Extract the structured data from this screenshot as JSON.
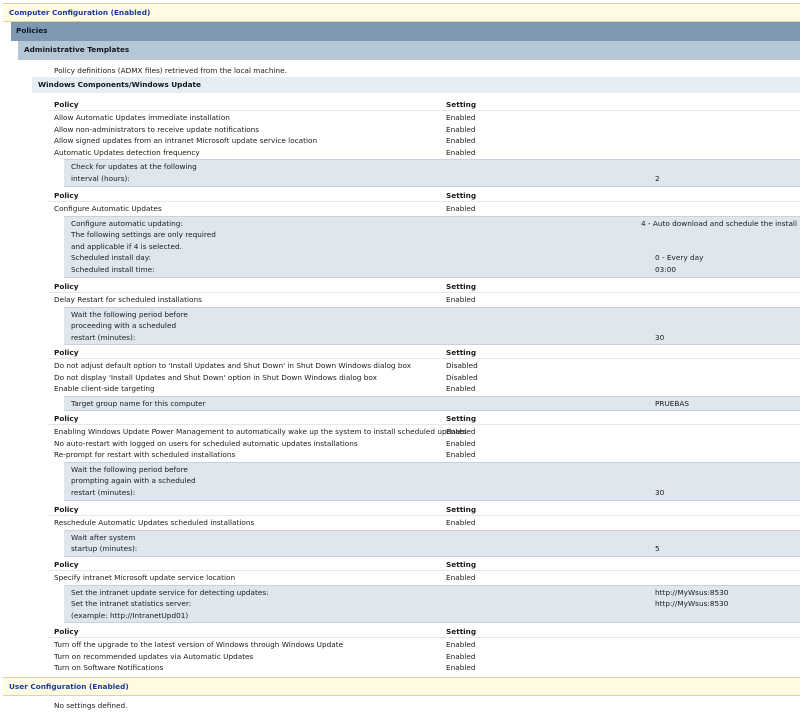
{
  "computer_config": {
    "title": "Computer Configuration (Enabled)",
    "policies_label": "Policies",
    "admin_templates_label": "Administrative Templates",
    "admx_note": "Policy definitions (ADMX files) retrieved from the local machine.",
    "component_label": "Windows Components/Windows Update"
  },
  "col_policy": "Policy",
  "col_setting": "Setting",
  "groups": [
    {
      "rows": [
        {
          "policy": "Allow Automatic Updates immediate installation",
          "setting": "Enabled"
        },
        {
          "policy": "Allow non-administrators to receive update notifications",
          "setting": "Enabled"
        },
        {
          "policy": "Allow signed updates from an intranet Microsoft update service location",
          "setting": "Enabled"
        },
        {
          "policy": "Automatic Updates detection frequency",
          "setting": "Enabled"
        }
      ],
      "details": [
        {
          "label": "Check for updates at the following",
          "value": ""
        },
        {
          "label": "interval (hours):",
          "value": "2"
        }
      ]
    },
    {
      "rows": [
        {
          "policy": "Configure Automatic Updates",
          "setting": "Enabled"
        }
      ],
      "details": [
        {
          "label": "Configure automatic updating:",
          "value": "4 - Auto download and schedule the install"
        },
        {
          "label": "The following settings are only required",
          "value": ""
        },
        {
          "label": "and applicable if 4 is selected.",
          "value": ""
        },
        {
          "label": "Scheduled install day:",
          "value": "0 - Every day"
        },
        {
          "label": "Scheduled install time:",
          "value": "03:00"
        }
      ]
    },
    {
      "rows": [
        {
          "policy": "Delay Restart for scheduled installations",
          "setting": "Enabled"
        }
      ],
      "details": [
        {
          "label": "Wait the following period before",
          "value": ""
        },
        {
          "label": "proceeding with a scheduled",
          "value": ""
        },
        {
          "label": "restart (minutes):",
          "value": "30"
        }
      ]
    },
    {
      "rows": [
        {
          "policy": "Do not adjust default option to 'Install Updates and Shut Down' in Shut Down Windows dialog box",
          "setting": "Disabled"
        },
        {
          "policy": "Do not display 'Install Updates and Shut Down' option in Shut Down Windows dialog box",
          "setting": "Disabled"
        },
        {
          "policy": "Enable client-side targeting",
          "setting": "Enabled"
        }
      ],
      "details": [
        {
          "label": "Target group name for this computer",
          "value": "PRUEBAS"
        }
      ]
    },
    {
      "rows": [
        {
          "policy": "Enabling Windows Update Power Management to automatically wake up the system to install scheduled updates",
          "setting": "Enabled"
        },
        {
          "policy": "No auto-restart with logged on users for scheduled automatic updates installations",
          "setting": "Enabled"
        },
        {
          "policy": "Re-prompt for restart with scheduled installations",
          "setting": "Enabled"
        }
      ],
      "details": [
        {
          "label": "Wait the following period before",
          "value": ""
        },
        {
          "label": "prompting again with a scheduled",
          "value": ""
        },
        {
          "label": "restart (minutes):",
          "value": "30"
        }
      ]
    },
    {
      "rows": [
        {
          "policy": "Reschedule Automatic Updates scheduled installations",
          "setting": "Enabled"
        }
      ],
      "details": [
        {
          "label": "Wait after system",
          "value": ""
        },
        {
          "label": "startup (minutes):",
          "value": "5"
        }
      ]
    },
    {
      "rows": [
        {
          "policy": "Specify intranet Microsoft update service location",
          "setting": "Enabled"
        }
      ],
      "details": [
        {
          "label": "Set the intranet update service for detecting updates:",
          "value": "http://MyWsus:8530"
        },
        {
          "label": "Set the intranet statistics server:",
          "value": "http://MyWsus:8530"
        },
        {
          "label": "(example: http://IntranetUpd01)",
          "value": ""
        }
      ]
    },
    {
      "rows": [
        {
          "policy": "Turn off the upgrade to the latest version of Windows through Windows Update",
          "setting": "Enabled"
        },
        {
          "policy": "Turn on recommended updates via Automatic Updates",
          "setting": "Enabled"
        },
        {
          "policy": "Turn on Software Notifications",
          "setting": "Enabled"
        }
      ],
      "details": []
    }
  ],
  "user_config": {
    "title": "User Configuration (Enabled)",
    "note": "No settings defined."
  }
}
